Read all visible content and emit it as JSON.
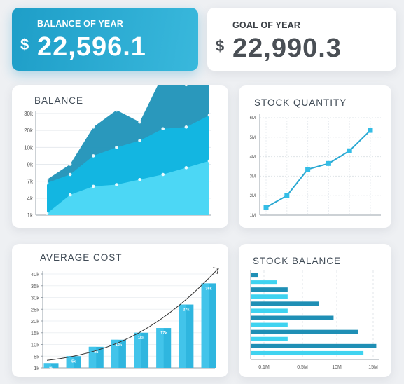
{
  "balance_of_year": {
    "title": "BALANCE OF YEAR",
    "currency": "$",
    "value": "22,596.1"
  },
  "goal_of_year": {
    "title": "GOAL OF YEAR",
    "currency": "$",
    "value": "22,990.3"
  },
  "colors": {
    "accent": "#2aa8d2",
    "dark_area": "#1f92b8",
    "mid_area": "#12b7e3",
    "light_area": "#4fd9f5",
    "bar_light": "#3fd3f0",
    "bar_dark": "#1f8fb5"
  },
  "chart_data": [
    {
      "type": "area",
      "title": "BALANCE",
      "y_tick_labels": [
        "1k",
        "4k",
        "7k",
        "9k",
        "10k",
        "20k",
        "30k"
      ],
      "x": [
        1,
        2,
        3,
        4,
        5,
        6,
        7,
        8
      ],
      "series": [
        {
          "values": [
            3.1,
            4.0,
            6.2,
            7.2,
            6.5,
            9.3,
            8.7,
            9.6
          ]
        },
        {
          "values": [
            2.9,
            3.4,
            4.5,
            5.0,
            5.4,
            6.1,
            6.2,
            6.9
          ]
        },
        {
          "values": [
            1.1,
            2.2,
            2.7,
            2.8,
            3.1,
            3.4,
            3.8,
            4.2
          ]
        }
      ]
    },
    {
      "type": "line",
      "title": "STOCK QUANTITY",
      "y_tick_labels": [
        "1M",
        "2M",
        "3M",
        "4M",
        "5M",
        "6M"
      ],
      "ylim": [
        1,
        6
      ],
      "x": [
        1,
        2,
        3,
        4,
        5,
        6
      ],
      "values": [
        1.4,
        2.0,
        3.35,
        3.65,
        4.3,
        5.35
      ]
    },
    {
      "type": "bar",
      "title": "AVERAGE COST",
      "y_tick_labels": [
        "1k",
        "5k",
        "10k",
        "15k",
        "20k",
        "25k",
        "30k",
        "35k",
        "40k"
      ],
      "ylim": [
        0,
        40
      ],
      "categories": [
        "2k",
        "5k",
        "9k",
        "12k",
        "15k",
        "17k",
        "27k",
        "36k"
      ],
      "values": [
        2,
        5,
        9,
        12,
        15,
        17,
        27,
        36
      ]
    },
    {
      "type": "bar",
      "orientation": "horizontal",
      "title": "STOCK BALANCE",
      "x_tick_labels": [
        "0.1M",
        "0.5M",
        "10M",
        "15M"
      ],
      "values": [
        0.6,
        2.4,
        3.4,
        3.4,
        6.3,
        3.4,
        7.7,
        3.4,
        10.0,
        3.4,
        11.7,
        10.5
      ]
    }
  ]
}
